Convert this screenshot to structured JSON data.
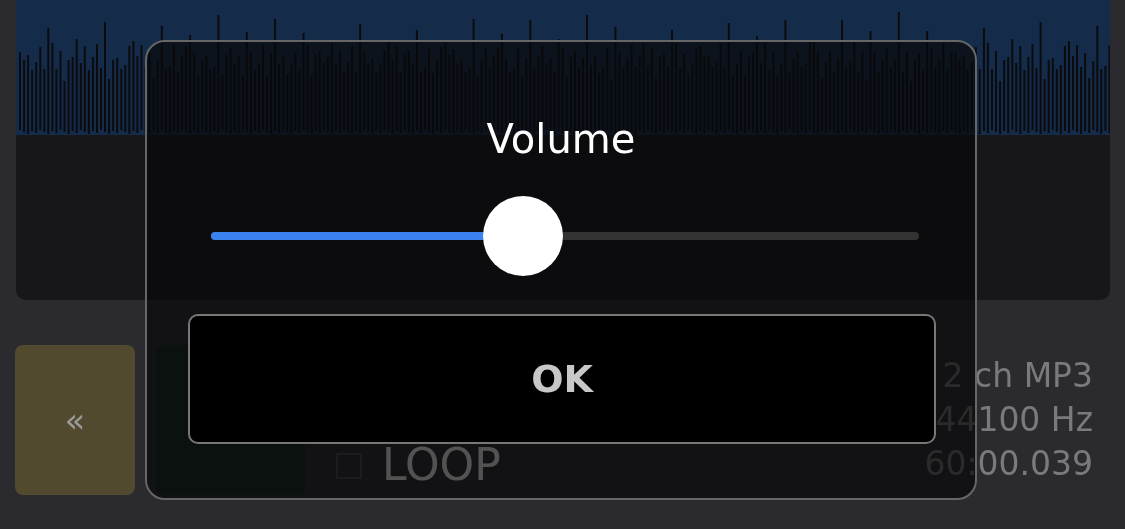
{
  "player": {
    "rewind_button": {
      "label": "«"
    },
    "loop": {
      "label": "LOOP",
      "checked": false
    },
    "info": [
      "2 ch MP3",
      "44100 Hz",
      "60:00.039"
    ]
  },
  "dialog": {
    "title": "Volume",
    "slider": {
      "level": 0.44
    },
    "ok_button": {
      "label": "OK"
    }
  }
}
